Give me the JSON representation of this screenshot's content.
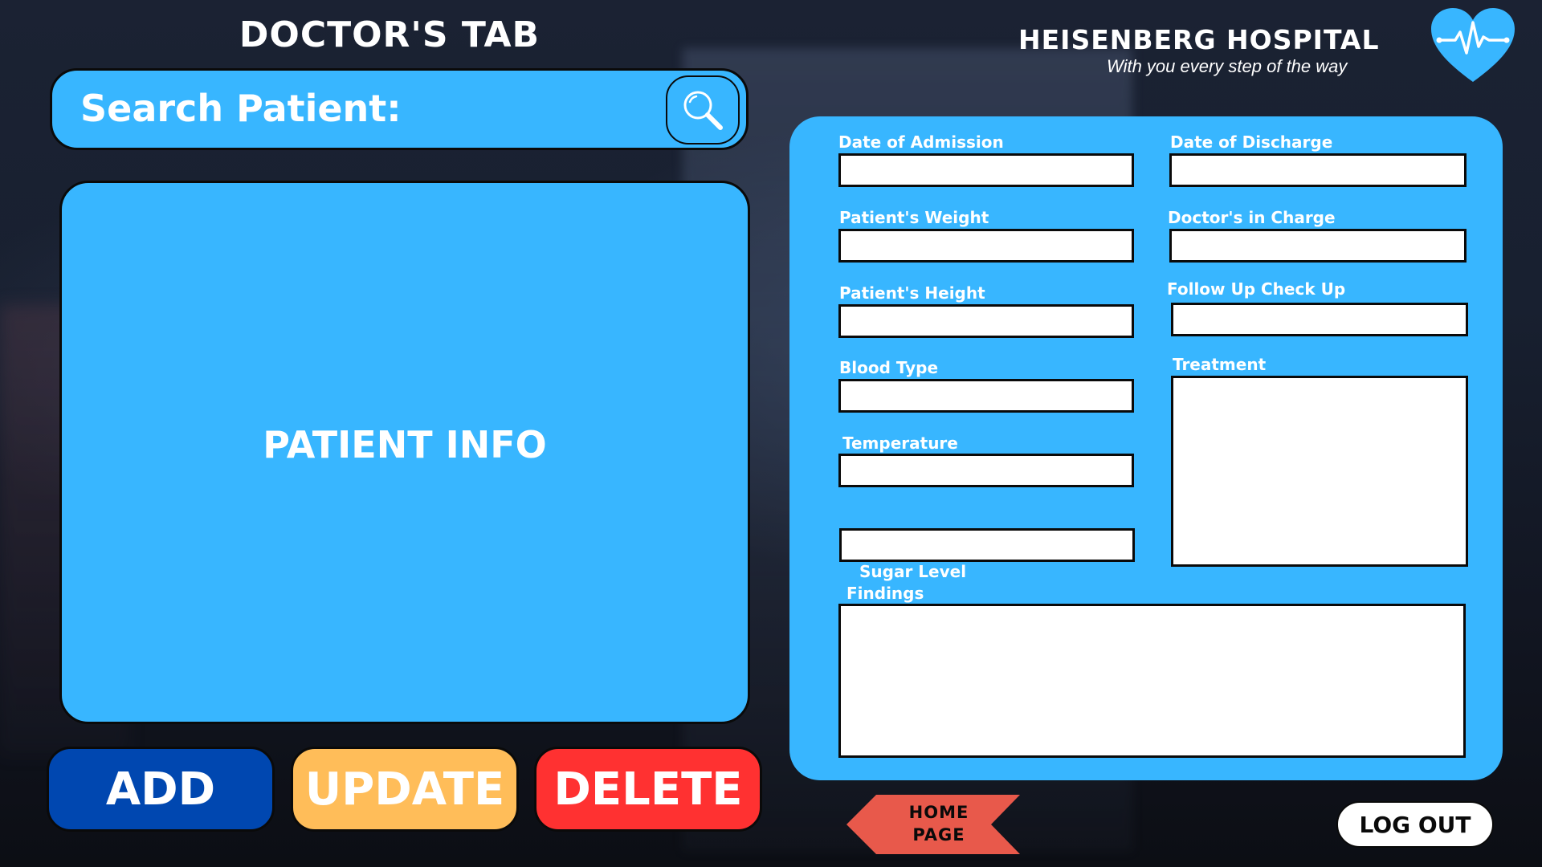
{
  "header": {
    "title": "DOCTOR'S TAB"
  },
  "brand": {
    "name": "HEISENBERG HOSPITAL",
    "tagline": "With you every step of the way",
    "logo_icon": "heart-pulse-icon"
  },
  "search": {
    "label": "Search Patient:",
    "icon": "search-icon"
  },
  "patient_info": {
    "title": "PATIENT INFO"
  },
  "actions": {
    "add_label": "ADD",
    "update_label": "UPDATE",
    "delete_label": "DELETE"
  },
  "form": {
    "date_of_admission": {
      "label": "Date of Admission",
      "value": ""
    },
    "date_of_discharge": {
      "label": "Date of Discharge",
      "value": ""
    },
    "patient_weight": {
      "label": "Patient's Weight",
      "value": ""
    },
    "doctor_in_charge": {
      "label": "Doctor's  in Charge",
      "value": ""
    },
    "patient_height": {
      "label": "Patient's Height",
      "value": ""
    },
    "follow_up_check_up": {
      "label": "Follow Up Check Up",
      "value": ""
    },
    "blood_type": {
      "label": "Blood Type",
      "value": ""
    },
    "treatment": {
      "label": "Treatment",
      "value": ""
    },
    "temperature": {
      "label": "Temperature",
      "value": ""
    },
    "sugar_level": {
      "label": "Sugar Level",
      "value": ""
    },
    "findings": {
      "label": "Findings",
      "value": ""
    }
  },
  "nav": {
    "home_line1": "HOME",
    "home_line2": "PAGE",
    "logout_label": "LOG OUT"
  },
  "colors": {
    "panel_blue": "#38b6ff",
    "add_blue": "#0047b0",
    "update_yellow": "#ffbd59",
    "delete_red": "#ff3131",
    "home_arrow": "#e8594b"
  }
}
